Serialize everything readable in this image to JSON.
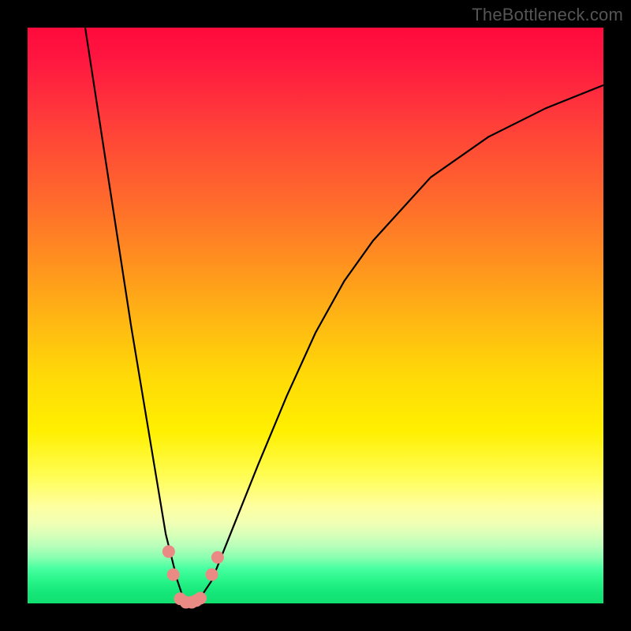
{
  "watermark": "TheBottleneck.com",
  "chart_data": {
    "type": "line",
    "title": "",
    "xlabel": "",
    "ylabel": "",
    "xlim": [
      0,
      100
    ],
    "ylim": [
      0,
      100
    ],
    "grid": false,
    "series": [
      {
        "name": "bottleneck-curve",
        "x": [
          10,
          12,
          14,
          16,
          18,
          20,
          22,
          24,
          26,
          27,
          28,
          29,
          30,
          32,
          34,
          36,
          40,
          45,
          50,
          55,
          60,
          70,
          80,
          90,
          100
        ],
        "y": [
          100,
          87,
          74,
          61,
          48,
          36,
          24,
          12,
          4,
          1,
          0,
          0,
          1,
          4,
          9,
          14,
          24,
          36,
          47,
          56,
          63,
          74,
          81,
          86,
          90
        ],
        "color": "#000000"
      }
    ],
    "markers": [
      {
        "name": "point-a",
        "x": 24.5,
        "y": 9,
        "color": "#e98b84"
      },
      {
        "name": "point-b",
        "x": 25.3,
        "y": 5,
        "color": "#e98b84"
      },
      {
        "name": "point-c",
        "x": 26.5,
        "y": 0.8,
        "color": "#e98b84"
      },
      {
        "name": "point-d",
        "x": 27.5,
        "y": 0.2,
        "color": "#e98b84"
      },
      {
        "name": "point-e",
        "x": 28.5,
        "y": 0.2,
        "color": "#e98b84"
      },
      {
        "name": "point-f",
        "x": 29.3,
        "y": 0.5,
        "color": "#e98b84"
      },
      {
        "name": "point-g",
        "x": 30.0,
        "y": 0.9,
        "color": "#e98b84"
      },
      {
        "name": "point-h",
        "x": 32.0,
        "y": 5,
        "color": "#e98b84"
      },
      {
        "name": "point-i",
        "x": 33.0,
        "y": 8,
        "color": "#e98b84"
      }
    ],
    "gradient_scale": {
      "top_color": "#ff0a3c",
      "bottom_color": "#10e070",
      "meaning": "red high to green low"
    }
  }
}
